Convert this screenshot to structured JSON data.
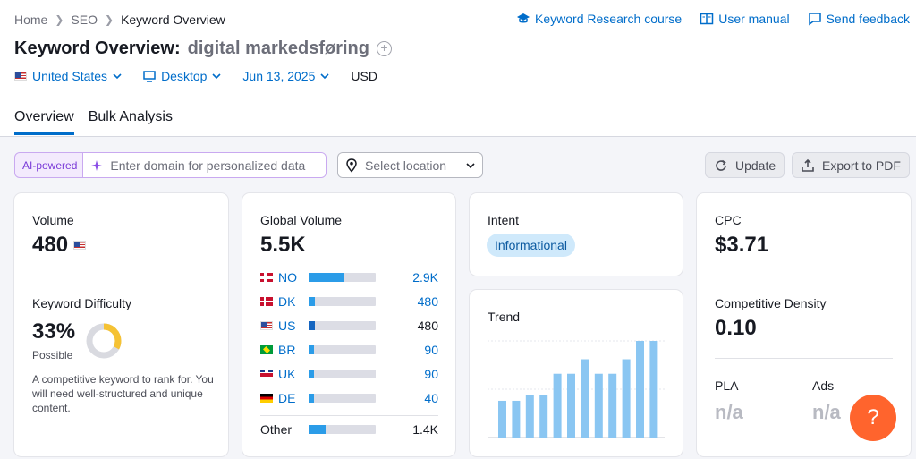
{
  "breadcrumb": {
    "items": [
      "Home",
      "SEO"
    ],
    "current": "Keyword Overview"
  },
  "toplinks": {
    "course": "Keyword Research course",
    "manual": "User manual",
    "feedback": "Send feedback"
  },
  "title": {
    "main": "Keyword Overview:",
    "keyword": "digital markedsføring"
  },
  "filters": {
    "country": "United States",
    "device": "Desktop",
    "date": "Jun 13, 2025",
    "currency": "USD"
  },
  "tabs": [
    "Overview",
    "Bulk Analysis"
  ],
  "toolbar": {
    "ai_badge": "AI-powered",
    "domain_placeholder": "Enter domain for personalized data",
    "location_placeholder": "Select location",
    "update_label": "Update",
    "export_label": "Export to PDF"
  },
  "volume": {
    "label": "Volume",
    "value": "480"
  },
  "difficulty": {
    "label": "Keyword Difficulty",
    "value": "33%",
    "percent": 33,
    "level": "Possible",
    "description": "A competitive keyword to rank for. You will need well-structured and unique content."
  },
  "global_volume": {
    "label": "Global Volume",
    "value": "5.5K",
    "countries": [
      {
        "code": "NO",
        "value": "2.9K",
        "share": 0.53
      },
      {
        "code": "DK",
        "value": "480",
        "share": 0.09
      },
      {
        "code": "US",
        "value": "480",
        "share": 0.09
      },
      {
        "code": "BR",
        "value": "90",
        "share": 0.02
      },
      {
        "code": "UK",
        "value": "90",
        "share": 0.02
      },
      {
        "code": "DE",
        "value": "40",
        "share": 0.01
      }
    ],
    "other": {
      "label": "Other",
      "value": "1.4K",
      "share": 0.25
    }
  },
  "intent": {
    "label": "Intent",
    "value": "Informational"
  },
  "trend": {
    "label": "Trend",
    "values": [
      0.38,
      0.38,
      0.44,
      0.44,
      0.66,
      0.66,
      0.81,
      0.66,
      0.66,
      0.81,
      1.0,
      1.0
    ]
  },
  "cpc": {
    "label": "CPC",
    "value": "$3.71"
  },
  "density": {
    "label": "Competitive Density",
    "value": "0.10"
  },
  "pla": {
    "label": "PLA",
    "value": "n/a"
  },
  "ads": {
    "label": "Ads",
    "value": "n/a"
  },
  "help": {
    "label": "?"
  },
  "colors": {
    "accent": "#006dca",
    "bar": "#2b9ce8",
    "trend_bar": "#8ac6f2",
    "kd": "#f5c234",
    "help": "#ff642d"
  }
}
